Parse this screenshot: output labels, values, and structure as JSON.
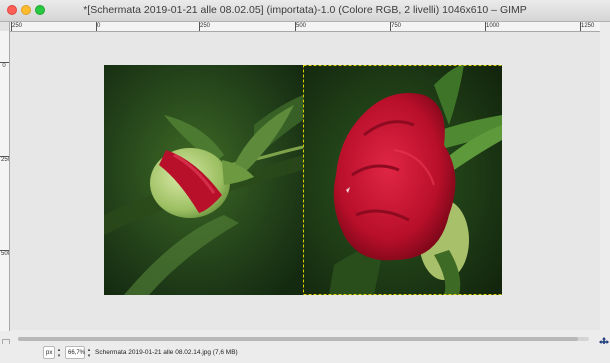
{
  "window": {
    "title": "*[Schermata 2019-01-21 alle 08.02.05] (importata)-1.0 (Colore RGB, 2 livelli) 1046x610 – GIMP"
  },
  "rulers": {
    "horizontal_labels": [
      "250",
      "0",
      "250",
      "500",
      "750",
      "1000",
      "1250"
    ],
    "vertical_labels": [
      "0",
      "250",
      "500"
    ]
  },
  "image": {
    "layers": [
      "left-bud",
      "right-bloom"
    ]
  },
  "statusbar": {
    "unit": "px",
    "zoom": "66,7%",
    "info": "Schermata 2019-01-21 alle 08.02.14.jpg (7,6 MB)"
  },
  "colors": {
    "bud_red": "#b8102a",
    "bloom_red": "#c0102e",
    "foliage": "#2f5a1c",
    "layer_boundary": "#d8d000"
  }
}
